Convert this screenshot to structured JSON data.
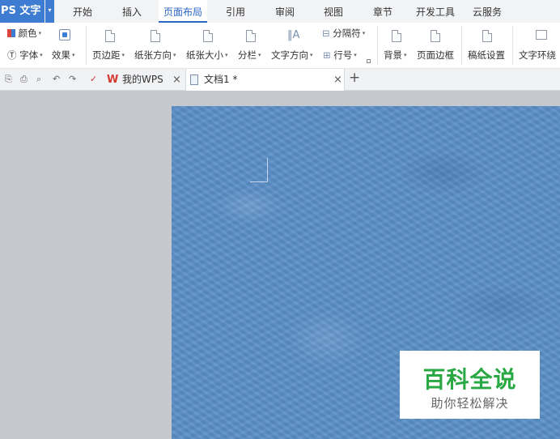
{
  "app": {
    "logo": "PS 文字",
    "menu_arrow": "▾"
  },
  "menu_tabs": [
    {
      "label": "开始"
    },
    {
      "label": "插入"
    },
    {
      "label": "页面布局"
    },
    {
      "label": "引用"
    },
    {
      "label": "审阅"
    },
    {
      "label": "视图"
    },
    {
      "label": "章节"
    },
    {
      "label": "开发工具"
    },
    {
      "label": "云服务"
    }
  ],
  "active_tab": "页面布局",
  "ribbon": {
    "color": "颜色",
    "font": "字体",
    "effect": "效果",
    "margins": "页边距",
    "orientation": "纸张方向",
    "size": "纸张大小",
    "columns": "分栏",
    "text_direction": "文字方向",
    "breaks": "分隔符",
    "line_numbers": "行号",
    "background": "背景",
    "page_border": "页面边框",
    "manuscript": "稿纸设置",
    "text_wrap": "文字环绕"
  },
  "doc_tabs": [
    {
      "label": "我的WPS",
      "close": "×"
    },
    {
      "label": "文档1 *",
      "close": "×"
    }
  ],
  "new_tab": "+",
  "page": {
    "background_color": "#5b8fc8"
  },
  "watermark": {
    "title": "百科全说",
    "subtitle": "助你轻松解决",
    "title_color": "#2aa843"
  }
}
